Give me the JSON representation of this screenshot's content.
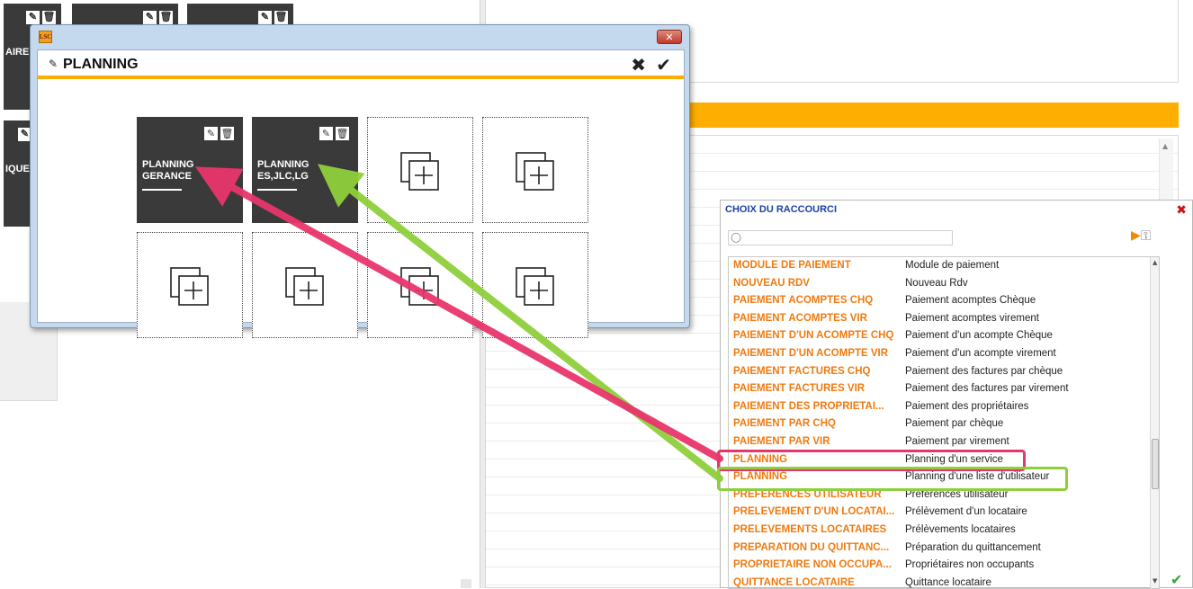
{
  "background": {
    "tiles": [
      {
        "label": "AIRE"
      },
      {
        "label": ""
      },
      {
        "label": ""
      },
      {
        "label": "IQUE"
      }
    ]
  },
  "icons": {
    "pencil": "✎",
    "trash": "🗑",
    "close_x": "✖",
    "check": "✔",
    "search": "○",
    "go": "▶",
    "key": "⚿",
    "ok": "✔",
    "win_close": "✕",
    "scroll_up": "▲",
    "scroll_down": "▼"
  },
  "dialog": {
    "logo": "LSC",
    "title": "PLANNING",
    "tiles": [
      {
        "label_line1": "PLANNING",
        "label_line2": "GERANCE"
      },
      {
        "label_line1": "PLANNING",
        "label_line2": "ES,JLC,LG"
      }
    ]
  },
  "chooser": {
    "title": "CHOIX DU RACCOURCI",
    "search_value": "",
    "rows": [
      {
        "code": "MODULE DE PAIEMENT",
        "desc": "Module de paiement"
      },
      {
        "code": "NOUVEAU RDV",
        "desc": "Nouveau Rdv"
      },
      {
        "code": "PAIEMENT ACOMPTES CHQ",
        "desc": "Paiement acomptes Chèque"
      },
      {
        "code": "PAIEMENT ACOMPTES VIR",
        "desc": "Paiement acomptes virement"
      },
      {
        "code": "PAIEMENT D'UN ACOMPTE CHQ",
        "desc": "Paiement d'un acompte Chèque"
      },
      {
        "code": "PAIEMENT D'UN ACOMPTE VIR",
        "desc": "Paiement d'un acompte virement"
      },
      {
        "code": "PAIEMENT FACTURES CHQ",
        "desc": "Paiement des factures par chèque"
      },
      {
        "code": "PAIEMENT FACTURES VIR",
        "desc": "Paiement des factures par virement"
      },
      {
        "code": "PAIEMENT DES PROPRIETAI...",
        "desc": "Paiement des propriétaires"
      },
      {
        "code": "PAIEMENT PAR CHQ",
        "desc": "Paiement par chèque"
      },
      {
        "code": "PAIEMENT PAR VIR",
        "desc": "Paiement par virement"
      },
      {
        "code": "PLANNING",
        "desc": "Planning d'un service"
      },
      {
        "code": "PLANNING",
        "desc": "Planning d'une liste d'utilisateur"
      },
      {
        "code": "PREFERENCES UTILISATEUR",
        "desc": "Préférences utilisateur"
      },
      {
        "code": "PRELEVEMENT D'UN LOCATAI...",
        "desc": "Prélèvement d'un locataire"
      },
      {
        "code": "PRELEVEMENTS LOCATAIRES",
        "desc": "Prélèvements locataires"
      },
      {
        "code": "PREPARATION DU QUITTANC...",
        "desc": "Préparation du quittancement"
      },
      {
        "code": "PROPRIETAIRE NON OCCUPA...",
        "desc": "Propriétaires non occupants"
      },
      {
        "code": "QUITTANCE LOCATAIRE",
        "desc": "Quittance locataire"
      }
    ]
  },
  "colors": {
    "accent_orange": "#fdae00",
    "code_orange": "#f07a10",
    "tile_dark": "#3a3a3a",
    "highlight_red": "#e8356b",
    "highlight_green": "#8fcf3c",
    "chooser_title_blue": "#1a3fa8"
  }
}
